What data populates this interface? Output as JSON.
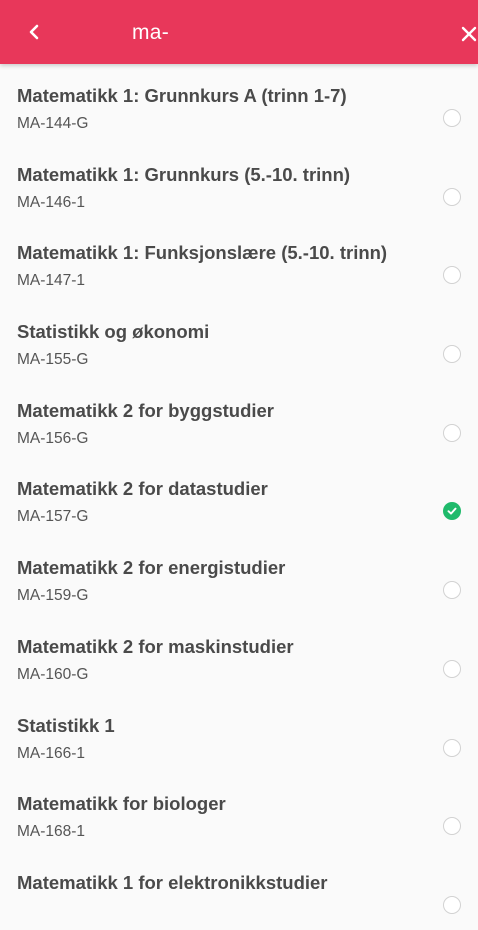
{
  "header": {
    "back_icon": "chevron-left-icon",
    "search_value": "ma-",
    "close_icon": "close-icon",
    "accent_color": "#e8375a"
  },
  "courses": [
    {
      "title": "Matematikk 1: Grunnkurs A (trinn 1-7)",
      "code": "MA-144-G",
      "selected": false
    },
    {
      "title": "Matematikk 1: Grunnkurs (5.-10. trinn)",
      "code": "MA-146-1",
      "selected": false
    },
    {
      "title": "Matematikk 1: Funksjonslære (5.-10. trinn)",
      "code": "MA-147-1",
      "selected": false
    },
    {
      "title": "Statistikk og økonomi",
      "code": "MA-155-G",
      "selected": false
    },
    {
      "title": "Matematikk 2 for byggstudier",
      "code": "MA-156-G",
      "selected": false
    },
    {
      "title": "Matematikk 2 for datastudier",
      "code": "MA-157-G",
      "selected": true
    },
    {
      "title": "Matematikk 2 for energistudier",
      "code": "MA-159-G",
      "selected": false
    },
    {
      "title": "Matematikk 2 for maskinstudier",
      "code": "MA-160-G",
      "selected": false
    },
    {
      "title": "Statistikk 1",
      "code": "MA-166-1",
      "selected": false
    },
    {
      "title": "Matematikk for biologer",
      "code": "MA-168-1",
      "selected": false
    },
    {
      "title": "Matematikk 1 for elektronikkstudier",
      "code": "",
      "selected": false
    }
  ],
  "selected_color": "#1fba6b"
}
